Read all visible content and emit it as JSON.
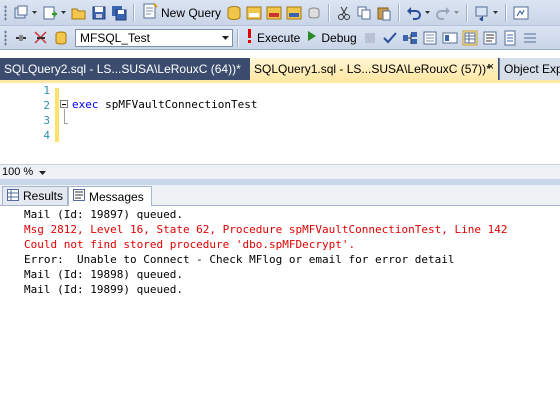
{
  "toolbar1": {
    "new_query_label": "New Query",
    "icons": [
      "new-project-icon",
      "add-item-icon",
      "open-file-icon",
      "save-icon",
      "save-all-icon",
      "database-engine-query-icon",
      "analysis-mdx-icon",
      "analysis-dmx-icon",
      "analysis-xmla-icon",
      "sql-compact-query-icon",
      "cut-icon",
      "copy-icon",
      "paste-icon",
      "undo-icon",
      "redo-icon",
      "navigate-backward-icon",
      "registered-servers-icon"
    ]
  },
  "toolbar2": {
    "database": "MFSQL_Test",
    "execute_label": "Execute",
    "debug_label": "Debug"
  },
  "tabs": [
    {
      "label": "SQLQuery2.sql - LS...SUSA\\LeRouxC (64))*",
      "active": false
    },
    {
      "label": "SQLQuery1.sql - LS...SUSA\\LeRouxC (57))*",
      "active": true,
      "close": "×"
    },
    {
      "label": "Object Exp",
      "active": false
    }
  ],
  "editor": {
    "line_numbers": [
      "1",
      "2",
      "3",
      "4"
    ],
    "code_keyword": "exec",
    "code_name": "spMFVaultConnectionTest"
  },
  "zoom": {
    "value": "100 %"
  },
  "result_tabs": {
    "results": "Results",
    "messages": "Messages"
  },
  "messages": [
    {
      "text": "Mail (Id: 19897) queued.",
      "error": false
    },
    {
      "text": "Msg 2812, Level 16, State 62, Procedure spMFVaultConnectionTest, Line 142",
      "error": true
    },
    {
      "text": "Could not find stored procedure 'dbo.spMFDecrypt'.",
      "error": true
    },
    {
      "text": "Error:  Unable to Connect - Check MFlog or email for error detail",
      "error": false
    },
    {
      "text": "Mail (Id: 19898) queued.",
      "error": false
    },
    {
      "text": "Mail (Id: 19899) queued.",
      "error": false
    }
  ],
  "colors": {
    "error": "#e00000",
    "active_tab": "#ffe8a6",
    "tab_strip": "#3b4c6e",
    "keyword": "#0000ff",
    "line_number": "#2b91af"
  }
}
